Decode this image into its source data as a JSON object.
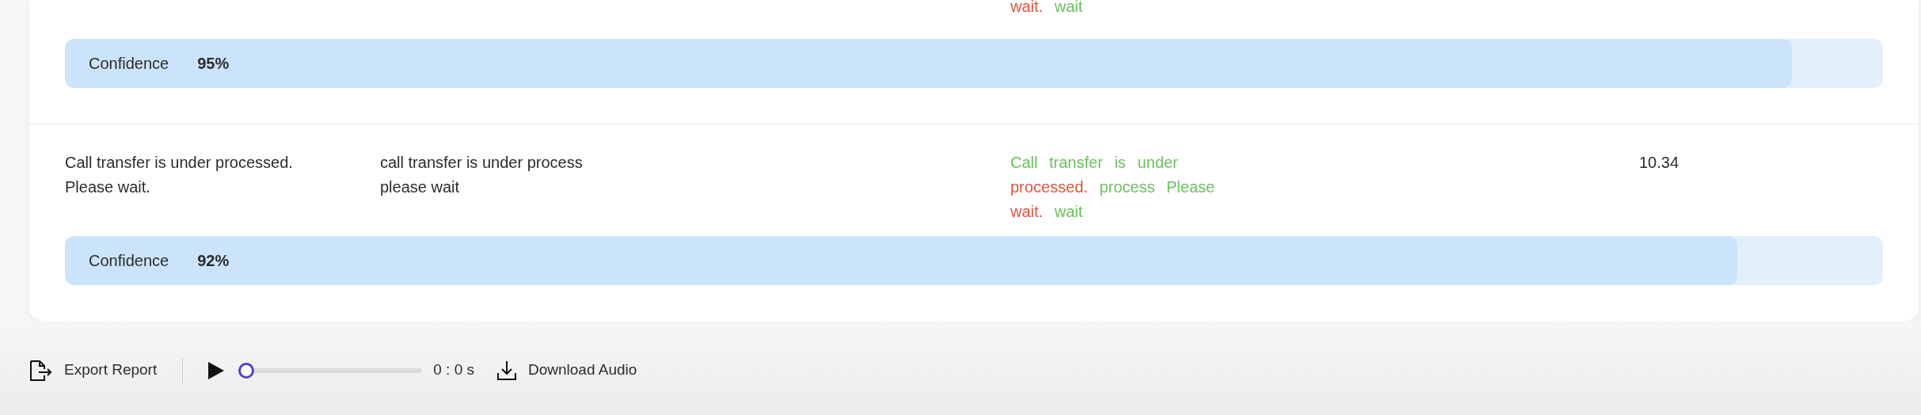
{
  "rows": [
    {
      "diff": [
        {
          "text": "wait.",
          "kind": "error"
        },
        {
          "text": "wait",
          "kind": "match"
        }
      ],
      "confidence": {
        "label": "Confidence",
        "value": "95%",
        "level": 0.95
      }
    },
    {
      "reference": "Call transfer is under processed. Please wait.",
      "hypothesis": "call transfer is under process please wait",
      "diff": [
        {
          "text": "Call",
          "kind": "match"
        },
        {
          "text": "transfer",
          "kind": "match"
        },
        {
          "text": "is",
          "kind": "match"
        },
        {
          "text": "under",
          "kind": "match"
        },
        {
          "text": "processed.",
          "kind": "error"
        },
        {
          "text": "process",
          "kind": "match"
        },
        {
          "text": "Please",
          "kind": "match"
        },
        {
          "text": "wait.",
          "kind": "error"
        },
        {
          "text": "wait",
          "kind": "match"
        }
      ],
      "time": "10.34",
      "confidence": {
        "label": "Confidence",
        "value": "92%",
        "level": 0.92
      }
    }
  ],
  "toolbar": {
    "export": "Export Report",
    "player": {
      "level": 0,
      "time": "0 : 0 s"
    },
    "download": "Download Audio"
  }
}
